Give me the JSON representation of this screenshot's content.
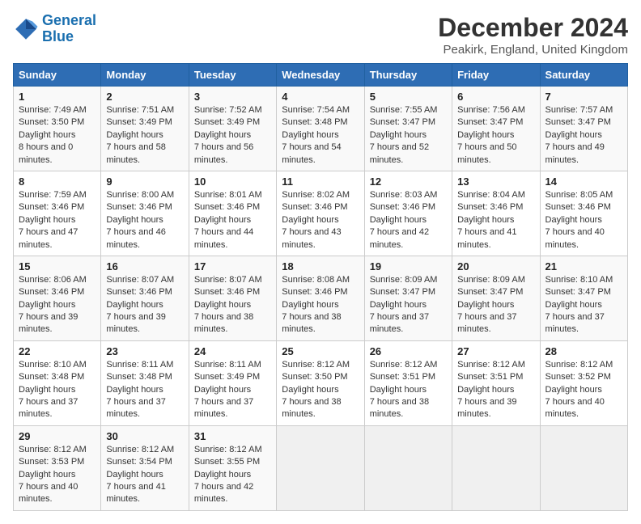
{
  "header": {
    "logo_line1": "General",
    "logo_line2": "Blue",
    "month_title": "December 2024",
    "location": "Peakirk, England, United Kingdom"
  },
  "days_of_week": [
    "Sunday",
    "Monday",
    "Tuesday",
    "Wednesday",
    "Thursday",
    "Friday",
    "Saturday"
  ],
  "weeks": [
    [
      {
        "day": 1,
        "sunrise": "7:49 AM",
        "sunset": "3:50 PM",
        "daylight": "8 hours and 0 minutes."
      },
      {
        "day": 2,
        "sunrise": "7:51 AM",
        "sunset": "3:49 PM",
        "daylight": "7 hours and 58 minutes."
      },
      {
        "day": 3,
        "sunrise": "7:52 AM",
        "sunset": "3:49 PM",
        "daylight": "7 hours and 56 minutes."
      },
      {
        "day": 4,
        "sunrise": "7:54 AM",
        "sunset": "3:48 PM",
        "daylight": "7 hours and 54 minutes."
      },
      {
        "day": 5,
        "sunrise": "7:55 AM",
        "sunset": "3:47 PM",
        "daylight": "7 hours and 52 minutes."
      },
      {
        "day": 6,
        "sunrise": "7:56 AM",
        "sunset": "3:47 PM",
        "daylight": "7 hours and 50 minutes."
      },
      {
        "day": 7,
        "sunrise": "7:57 AM",
        "sunset": "3:47 PM",
        "daylight": "7 hours and 49 minutes."
      }
    ],
    [
      {
        "day": 8,
        "sunrise": "7:59 AM",
        "sunset": "3:46 PM",
        "daylight": "7 hours and 47 minutes."
      },
      {
        "day": 9,
        "sunrise": "8:00 AM",
        "sunset": "3:46 PM",
        "daylight": "7 hours and 46 minutes."
      },
      {
        "day": 10,
        "sunrise": "8:01 AM",
        "sunset": "3:46 PM",
        "daylight": "7 hours and 44 minutes."
      },
      {
        "day": 11,
        "sunrise": "8:02 AM",
        "sunset": "3:46 PM",
        "daylight": "7 hours and 43 minutes."
      },
      {
        "day": 12,
        "sunrise": "8:03 AM",
        "sunset": "3:46 PM",
        "daylight": "7 hours and 42 minutes."
      },
      {
        "day": 13,
        "sunrise": "8:04 AM",
        "sunset": "3:46 PM",
        "daylight": "7 hours and 41 minutes."
      },
      {
        "day": 14,
        "sunrise": "8:05 AM",
        "sunset": "3:46 PM",
        "daylight": "7 hours and 40 minutes."
      }
    ],
    [
      {
        "day": 15,
        "sunrise": "8:06 AM",
        "sunset": "3:46 PM",
        "daylight": "7 hours and 39 minutes."
      },
      {
        "day": 16,
        "sunrise": "8:07 AM",
        "sunset": "3:46 PM",
        "daylight": "7 hours and 39 minutes."
      },
      {
        "day": 17,
        "sunrise": "8:07 AM",
        "sunset": "3:46 PM",
        "daylight": "7 hours and 38 minutes."
      },
      {
        "day": 18,
        "sunrise": "8:08 AM",
        "sunset": "3:46 PM",
        "daylight": "7 hours and 38 minutes."
      },
      {
        "day": 19,
        "sunrise": "8:09 AM",
        "sunset": "3:47 PM",
        "daylight": "7 hours and 37 minutes."
      },
      {
        "day": 20,
        "sunrise": "8:09 AM",
        "sunset": "3:47 PM",
        "daylight": "7 hours and 37 minutes."
      },
      {
        "day": 21,
        "sunrise": "8:10 AM",
        "sunset": "3:47 PM",
        "daylight": "7 hours and 37 minutes."
      }
    ],
    [
      {
        "day": 22,
        "sunrise": "8:10 AM",
        "sunset": "3:48 PM",
        "daylight": "7 hours and 37 minutes."
      },
      {
        "day": 23,
        "sunrise": "8:11 AM",
        "sunset": "3:48 PM",
        "daylight": "7 hours and 37 minutes."
      },
      {
        "day": 24,
        "sunrise": "8:11 AM",
        "sunset": "3:49 PM",
        "daylight": "7 hours and 37 minutes."
      },
      {
        "day": 25,
        "sunrise": "8:12 AM",
        "sunset": "3:50 PM",
        "daylight": "7 hours and 38 minutes."
      },
      {
        "day": 26,
        "sunrise": "8:12 AM",
        "sunset": "3:51 PM",
        "daylight": "7 hours and 38 minutes."
      },
      {
        "day": 27,
        "sunrise": "8:12 AM",
        "sunset": "3:51 PM",
        "daylight": "7 hours and 39 minutes."
      },
      {
        "day": 28,
        "sunrise": "8:12 AM",
        "sunset": "3:52 PM",
        "daylight": "7 hours and 40 minutes."
      }
    ],
    [
      {
        "day": 29,
        "sunrise": "8:12 AM",
        "sunset": "3:53 PM",
        "daylight": "7 hours and 40 minutes."
      },
      {
        "day": 30,
        "sunrise": "8:12 AM",
        "sunset": "3:54 PM",
        "daylight": "7 hours and 41 minutes."
      },
      {
        "day": 31,
        "sunrise": "8:12 AM",
        "sunset": "3:55 PM",
        "daylight": "7 hours and 42 minutes."
      },
      null,
      null,
      null,
      null
    ]
  ]
}
